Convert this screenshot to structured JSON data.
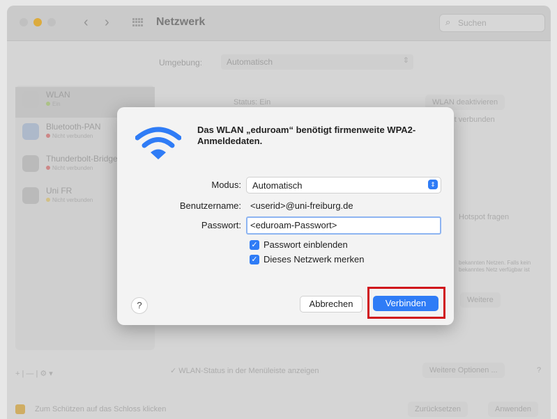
{
  "window": {
    "title": "Netzwerk",
    "search_placeholder": "Suchen",
    "nav_back": "‹",
    "nav_forward": "›"
  },
  "background": {
    "environment_label": "Umgebung:",
    "environment_value": "Automatisch",
    "sidebar": [
      {
        "name": "WLAN",
        "status": "Ein",
        "status_color": "#b8d28a",
        "icon": "wifi-icon",
        "selected": true
      },
      {
        "name": "Bluetooth-PAN",
        "status": "Nicht verbunden",
        "status_color": "#e08a8a",
        "icon": "bluetooth-icon",
        "selected": false
      },
      {
        "name": "Thunderbolt-Bridge",
        "status": "Nicht verbunden",
        "status_color": "#e08a8a",
        "icon": "thunderbolt-icon",
        "selected": false
      },
      {
        "name": "Uni FR",
        "status": "Nicht verbunden",
        "status_color": "#e6d08a",
        "icon": "vpn-icon",
        "selected": false
      }
    ],
    "sidebar_controls": "+ | — | ⚙ ▾",
    "status_text": "Status: Ein",
    "wlan_off_button": "WLAN deaktivieren",
    "connected_text": "mit verbunden",
    "hotspot_text": "Hotspot fragen",
    "hotspot_sub": "bekannten Netzen. Falls kein bekanntes Netz verfügbar ist",
    "advanced_field": "Weitere",
    "menu_bar_checkbox": "✓  WLAN-Status in der Menüleiste anzeigen",
    "more_options_button": "Weitere Optionen ...",
    "help_button": "?",
    "lock_text": "Zum Schützen auf das Schloss klicken",
    "revert_button": "Zurücksetzen",
    "apply_button": "Anwenden"
  },
  "dialog": {
    "title": "Das WLAN „eduroam“ benötigt firmenweite WPA2-Anmeldedaten.",
    "mode_label": "Modus:",
    "mode_value": "Automatisch",
    "username_label": "Benutzername:",
    "username_value": "<userid>@uni-freiburg.de",
    "password_label": "Passwort:",
    "password_value": "<eduroam-Passwort>",
    "show_password_label": "Passwort einblenden",
    "show_password_checked": true,
    "remember_label": "Dieses Netzwerk merken",
    "remember_checked": true,
    "help_label": "?",
    "cancel_label": "Abbrechen",
    "connect_label": "Verbinden",
    "accent_color": "#2f7cf6",
    "highlight_color": "#d0131b"
  }
}
